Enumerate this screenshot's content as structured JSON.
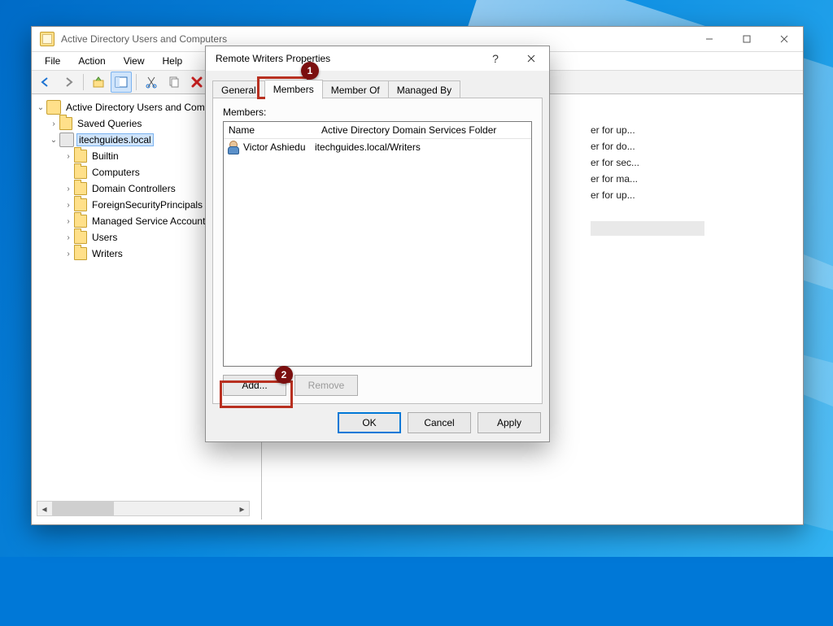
{
  "mmc": {
    "title": "Active Directory Users and Computers",
    "menus": [
      "File",
      "Action",
      "View",
      "Help"
    ],
    "tree": {
      "root": "Active Directory Users and Computers",
      "saved": "Saved Queries",
      "domain": "itechguides.local",
      "children": [
        "Builtin",
        "Computers",
        "Domain Controllers",
        "ForeignSecurityPrincipals",
        "Managed Service Accounts",
        "Users",
        "Writers"
      ]
    },
    "list_peek": [
      "er for up...",
      "er for do...",
      "er for sec...",
      "er for ma...",
      "er for up..."
    ]
  },
  "dialog": {
    "title": "Remote Writers Properties",
    "help": "?",
    "tabs": [
      "General",
      "Members",
      "Member Of",
      "Managed By"
    ],
    "active_tab": 1,
    "members_label": "Members:",
    "columns": [
      "Name",
      "Active Directory Domain Services Folder"
    ],
    "rows": [
      {
        "name": "Victor Ashiedu",
        "folder": "itechguides.local/Writers"
      }
    ],
    "add": "Add...",
    "remove": "Remove",
    "ok": "OK",
    "cancel": "Cancel",
    "apply": "Apply"
  },
  "callouts": {
    "b1": "1",
    "b2": "2"
  }
}
